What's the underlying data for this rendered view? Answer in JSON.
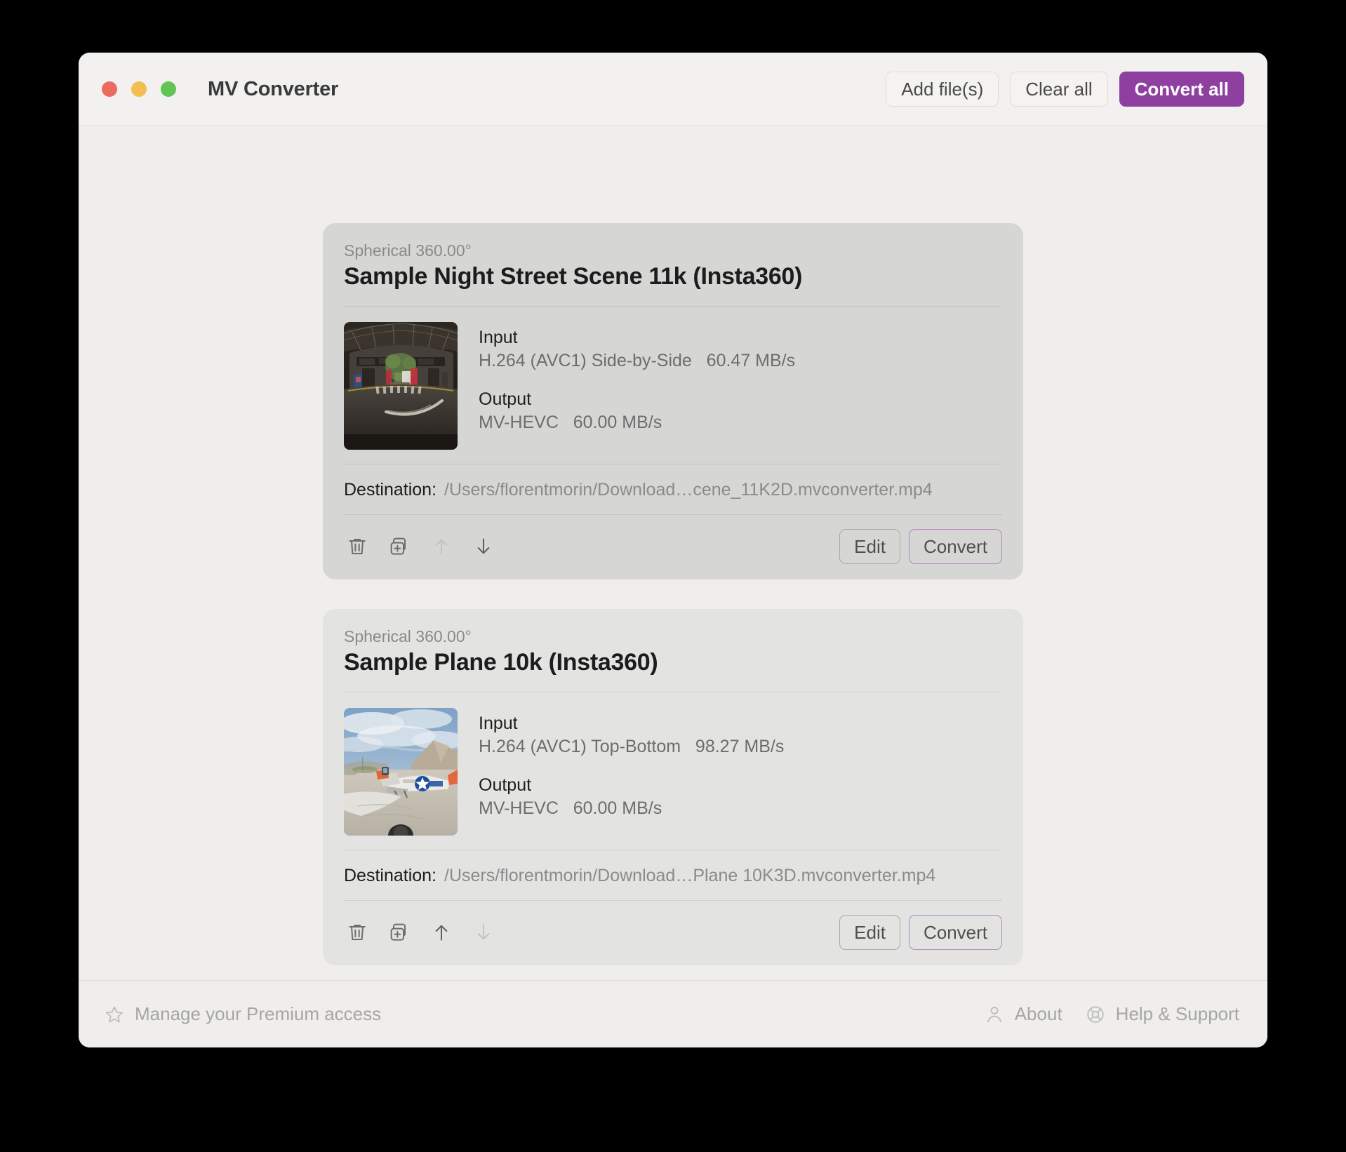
{
  "window": {
    "title": "MV Converter",
    "traffic_lights": [
      "close",
      "minimize",
      "maximize"
    ],
    "toolbar": {
      "add_files": "Add file(s)",
      "clear_all": "Clear all",
      "convert_all": "Convert all"
    },
    "accent_color": "#8e3fa0"
  },
  "cards": [
    {
      "kind": "Spherical 360.00°",
      "title": "Sample Night Street Scene 11k (Insta360)",
      "thumbnail": "night-street-360-thumbnail",
      "input_label": "Input",
      "input_value": "H.264 (AVC1) Side-by-Side   60.47 MB/s",
      "output_label": "Output",
      "output_value": "MV-HEVC   60.00 MB/s",
      "destination_label": "Destination:",
      "destination_path": "/Users/florentmorin/Download…cene_11K2D.mvconverter.mp4",
      "icons": {
        "delete": "trash-icon",
        "duplicate": "duplicate-icon",
        "move_up": "arrow-up-icon",
        "move_down": "arrow-down-icon",
        "move_up_enabled": false,
        "move_down_enabled": true
      },
      "edit_label": "Edit",
      "convert_label": "Convert"
    },
    {
      "kind": "Spherical 360.00°",
      "title": "Sample Plane 10k (Insta360)",
      "thumbnail": "desert-plane-360-thumbnail",
      "input_label": "Input",
      "input_value": "H.264 (AVC1) Top-Bottom   98.27 MB/s",
      "output_label": "Output",
      "output_value": "MV-HEVC   60.00 MB/s",
      "destination_label": "Destination:",
      "destination_path": "/Users/florentmorin/Download…Plane 10K3D.mvconverter.mp4",
      "icons": {
        "delete": "trash-icon",
        "duplicate": "duplicate-icon",
        "move_up": "arrow-up-icon",
        "move_down": "arrow-down-icon",
        "move_up_enabled": true,
        "move_down_enabled": false
      },
      "edit_label": "Edit",
      "convert_label": "Convert"
    }
  ],
  "footer": {
    "premium_label": "Manage your Premium access",
    "premium_icon": "star-icon",
    "about_label": "About",
    "about_icon": "person-icon",
    "help_label": "Help & Support",
    "help_icon": "lifebuoy-icon"
  }
}
